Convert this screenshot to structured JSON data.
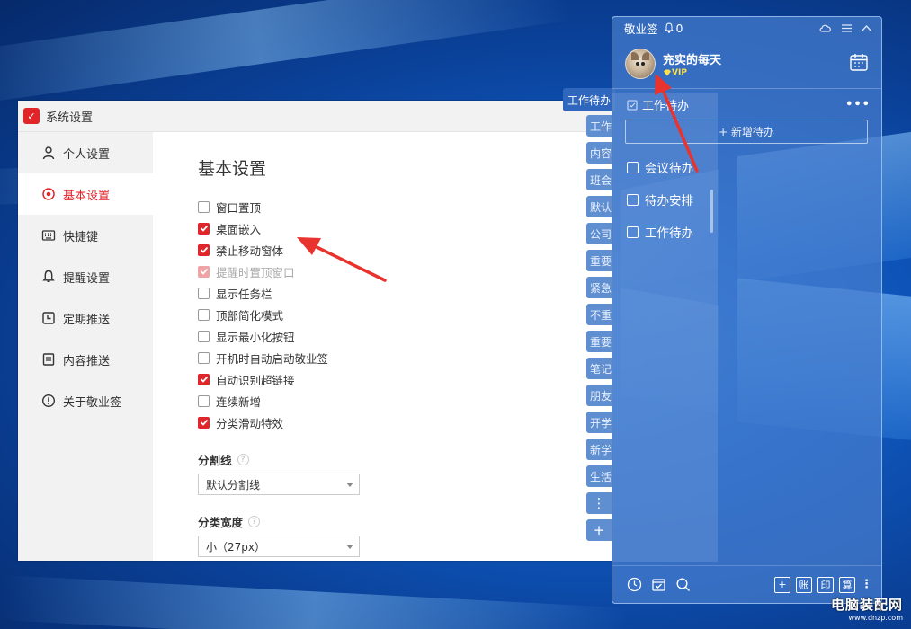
{
  "settings_window": {
    "title": "系统设置",
    "sidebar": [
      {
        "label": "个人设置",
        "icon": "person-icon",
        "active": false
      },
      {
        "label": "基本设置",
        "icon": "settings-icon",
        "active": true
      },
      {
        "label": "快捷键",
        "icon": "keyboard-icon",
        "active": false
      },
      {
        "label": "提醒设置",
        "icon": "bell-icon",
        "active": false
      },
      {
        "label": "定期推送",
        "icon": "calendar-icon",
        "active": false
      },
      {
        "label": "内容推送",
        "icon": "document-icon",
        "active": false
      },
      {
        "label": "关于敬业签",
        "icon": "info-icon",
        "active": false
      }
    ],
    "heading": "基本设置",
    "options": [
      {
        "label": "窗口置顶",
        "checked": false,
        "disabled": false
      },
      {
        "label": "桌面嵌入",
        "checked": true,
        "disabled": false
      },
      {
        "label": "禁止移动窗体",
        "checked": true,
        "disabled": false
      },
      {
        "label": "提醒时置顶窗口",
        "checked": true,
        "disabled": true
      },
      {
        "label": "显示任务栏",
        "checked": false,
        "disabled": false
      },
      {
        "label": "顶部简化模式",
        "checked": false,
        "disabled": false
      },
      {
        "label": "显示最小化按钮",
        "checked": false,
        "disabled": false
      },
      {
        "label": "开机时自动启动敬业签",
        "checked": false,
        "disabled": false
      },
      {
        "label": "自动识别超链接",
        "checked": true,
        "disabled": false
      },
      {
        "label": "连续新增",
        "checked": false,
        "disabled": false
      },
      {
        "label": "分类滑动特效",
        "checked": true,
        "disabled": false
      }
    ],
    "divider_label": "分割线",
    "divider_value": "默认分割线",
    "width_label": "分类宽度",
    "width_value": "小（27px）",
    "help_mark": "?"
  },
  "category_tabs": {
    "active": "工作待办",
    "items": [
      "工作",
      "内容",
      "班会",
      "默认",
      "公司",
      "重要",
      "紧急",
      "不重",
      "重要",
      "笔记",
      "朋友",
      "开学",
      "新学",
      "生活"
    ],
    "more": "⋮",
    "add": "+"
  },
  "widget": {
    "app_name": "敬业签",
    "notification_count": "0",
    "username": "充实的每天",
    "vip_label": "VIP",
    "section_title": "工作待办",
    "more": "•••",
    "new_todo": "+ 新增待办",
    "todos": [
      "会议待办",
      "待办安排",
      "工作待办"
    ],
    "footer_buttons": [
      "账",
      "印",
      "算"
    ],
    "add_button": "+",
    "kebab": "⋮"
  },
  "watermark": {
    "main": "电脑装配网",
    "sub": "www.dnzp.com"
  },
  "colors": {
    "accent_red": "#e0252b",
    "widget_blue": "#467dcd",
    "tab_blue": "#5f8fd0"
  }
}
